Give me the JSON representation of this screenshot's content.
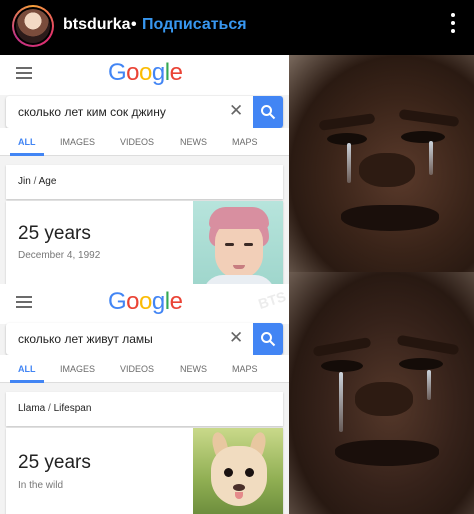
{
  "header": {
    "username": "btsdurka",
    "separator": "•",
    "follow": "Подписаться"
  },
  "panels": [
    {
      "query": "сколько лет ким сок джину",
      "tabs": [
        "ALL",
        "IMAGES",
        "VIDEOS",
        "NEWS",
        "MAPS"
      ],
      "breadcrumb_entity": "Jin",
      "breadcrumb_sep": "/",
      "breadcrumb_attr": "Age",
      "answer": "25 years",
      "detail": "December 4, 1992"
    },
    {
      "query": "сколько лет живут ламы",
      "tabs": [
        "ALL",
        "IMAGES",
        "VIDEOS",
        "NEWS",
        "MAPS"
      ],
      "breadcrumb_entity": "Llama",
      "breadcrumb_sep": "/",
      "breadcrumb_attr": "Lifespan",
      "answer": "25 years",
      "detail": "In the wild"
    }
  ],
  "logo": {
    "g": "G",
    "o1": "o",
    "o2": "o",
    "g2": "g",
    "l": "l",
    "e": "e"
  },
  "close_glyph": "✕",
  "watermark": "BTS",
  "colors": {
    "google_blue": "#4285f4",
    "ig_follow": "#3897f0"
  }
}
